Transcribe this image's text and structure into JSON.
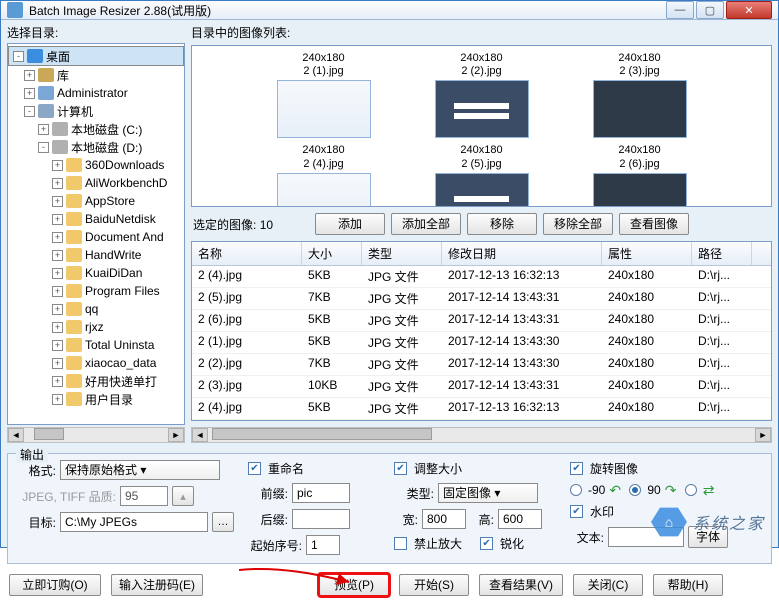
{
  "window": {
    "title": "Batch Image Resizer 2.88(试用版)"
  },
  "left": {
    "label": "选择目录:",
    "tree": [
      {
        "depth": 0,
        "twist": "-",
        "icon": "desktop",
        "label": "桌面",
        "sel": true
      },
      {
        "depth": 1,
        "twist": "+",
        "icon": "lib",
        "label": "库"
      },
      {
        "depth": 1,
        "twist": "+",
        "icon": "user",
        "label": "Administrator"
      },
      {
        "depth": 1,
        "twist": "-",
        "icon": "comp",
        "label": "计算机"
      },
      {
        "depth": 2,
        "twist": "+",
        "icon": "drive",
        "label": "本地磁盘 (C:)"
      },
      {
        "depth": 2,
        "twist": "-",
        "icon": "drive",
        "label": "本地磁盘 (D:)"
      },
      {
        "depth": 3,
        "twist": "+",
        "icon": "folder",
        "label": "360Downloads"
      },
      {
        "depth": 3,
        "twist": "+",
        "icon": "folder",
        "label": "AliWorkbenchD"
      },
      {
        "depth": 3,
        "twist": "+",
        "icon": "folder",
        "label": "AppStore"
      },
      {
        "depth": 3,
        "twist": "+",
        "icon": "folder",
        "label": "BaiduNetdisk"
      },
      {
        "depth": 3,
        "twist": "+",
        "icon": "folder",
        "label": "Document And"
      },
      {
        "depth": 3,
        "twist": "+",
        "icon": "folder",
        "label": "HandWrite"
      },
      {
        "depth": 3,
        "twist": "+",
        "icon": "folder",
        "label": "KuaiDiDan"
      },
      {
        "depth": 3,
        "twist": "+",
        "icon": "folder",
        "label": "Program Files"
      },
      {
        "depth": 3,
        "twist": "+",
        "icon": "folder",
        "label": "qq"
      },
      {
        "depth": 3,
        "twist": "+",
        "icon": "folder",
        "label": "rjxz"
      },
      {
        "depth": 3,
        "twist": "+",
        "icon": "folder",
        "label": "Total Uninsta"
      },
      {
        "depth": 3,
        "twist": "+",
        "icon": "folder",
        "label": "xiaocao_data"
      },
      {
        "depth": 3,
        "twist": "+",
        "icon": "folder",
        "label": "好用快递单打"
      },
      {
        "depth": 3,
        "twist": "+",
        "icon": "folder",
        "label": "用户目录"
      }
    ]
  },
  "right": {
    "label": "目录中的图像列表:",
    "thumbs": [
      {
        "dims": "240x180",
        "name": "2 (1).jpg",
        "pv": "t1"
      },
      {
        "dims": "240x180",
        "name": "2 (2).jpg",
        "pv": "t2"
      },
      {
        "dims": "240x180",
        "name": "2 (3).jpg",
        "pv": "t3"
      },
      {
        "dims": "240x180",
        "name": "2 (4).jpg",
        "pv": "t1"
      },
      {
        "dims": "240x180",
        "name": "2 (5).jpg",
        "pv": "t2"
      },
      {
        "dims": "240x180",
        "name": "2 (6).jpg",
        "pv": "t3"
      }
    ],
    "selected_label": "选定的图像:",
    "selected_count": "10",
    "buttons": {
      "add": "添加",
      "add_all": "添加全部",
      "remove": "移除",
      "remove_all": "移除全部",
      "view": "查看图像"
    },
    "columns": [
      "名称",
      "大小",
      "类型",
      "修改日期",
      "属性",
      "路径"
    ],
    "rows": [
      [
        "2 (4).jpg",
        "5KB",
        "JPG 文件",
        "2017-12-13 16:32:13",
        "240x180",
        "D:\\rj..."
      ],
      [
        "2 (5).jpg",
        "7KB",
        "JPG 文件",
        "2017-12-14 13:43:31",
        "240x180",
        "D:\\rj..."
      ],
      [
        "2 (6).jpg",
        "5KB",
        "JPG 文件",
        "2017-12-14 13:43:31",
        "240x180",
        "D:\\rj..."
      ],
      [
        "2 (1).jpg",
        "5KB",
        "JPG 文件",
        "2017-12-14 13:43:30",
        "240x180",
        "D:\\rj..."
      ],
      [
        "2 (2).jpg",
        "7KB",
        "JPG 文件",
        "2017-12-14 13:43:30",
        "240x180",
        "D:\\rj..."
      ],
      [
        "2 (3).jpg",
        "10KB",
        "JPG 文件",
        "2017-12-14 13:43:31",
        "240x180",
        "D:\\rj..."
      ],
      [
        "2 (4).jpg",
        "5KB",
        "JPG 文件",
        "2017-12-13 16:32:13",
        "240x180",
        "D:\\rj..."
      ]
    ]
  },
  "output": {
    "group": "输出",
    "format_label": "格式:",
    "format_value": "保持原始格式",
    "quality_label": "JPEG, TIFF 品质:",
    "quality_value": "95",
    "target_label": "目标:",
    "target_value": "C:\\My JPEGs",
    "rename_chk": "重命名",
    "prefix_label": "前缀:",
    "prefix_value": "pic",
    "suffix_label": "后缀:",
    "suffix_value": "",
    "startnum_label": "起始序号:",
    "startnum_value": "1",
    "resize_chk": "调整大小",
    "type_label": "类型:",
    "type_value": "固定图像",
    "width_label": "宽:",
    "width_value": "800",
    "height_label": "高:",
    "height_value": "600",
    "noenlarge_chk": "禁止放大",
    "sharpen_chk": "锐化",
    "rotate_chk": "旋转图像",
    "rot_neg90": "-90",
    "rot_90": "90",
    "watermark_chk": "水印",
    "wm_text_label": "文本:",
    "wm_font_btn": "字体"
  },
  "footer": {
    "order": "立即订购(O)",
    "regcode": "输入注册码(E)",
    "preview": "预览(P)",
    "start": "开始(S)",
    "result": "查看结果(V)",
    "close": "关闭(C)",
    "help": "帮助(H)"
  },
  "annotation": {
    "brand": "系统之家"
  }
}
